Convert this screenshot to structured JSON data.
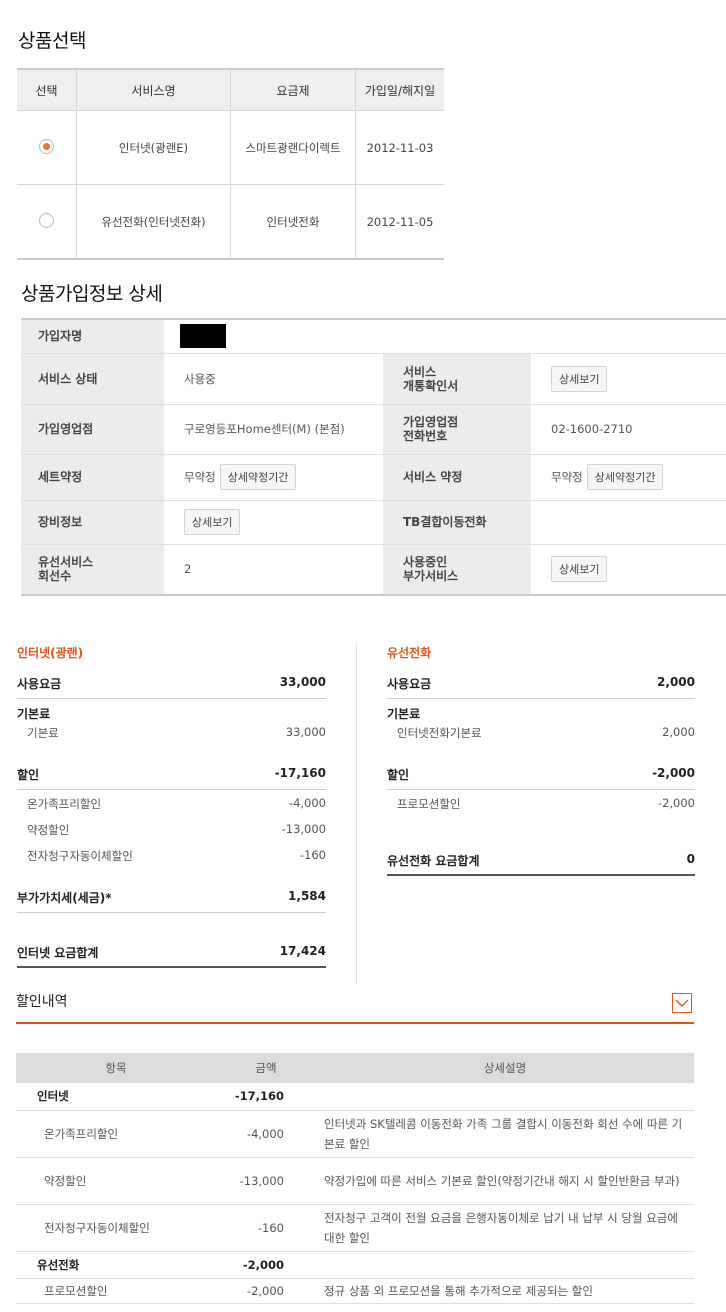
{
  "product_select": {
    "title": "상품선택",
    "headers": [
      "선택",
      "서비스명",
      "요금제",
      "가입일/해지일"
    ],
    "rows": [
      {
        "selected": true,
        "service": "인터넷(광랜E)",
        "plan": "스마트광랜다이렉트",
        "date": "2012-11-03"
      },
      {
        "selected": false,
        "service": "유선전화(인터넷전화)",
        "plan": "인터넷전화",
        "date": "2012-11-05"
      }
    ]
  },
  "detail": {
    "title": "상품가입정보 상세",
    "subscriber_label": "가입자명",
    "service_status_label": "서비스 상태",
    "service_status_value": "사용중",
    "service_cert_label1": "서비스",
    "service_cert_label2": "개통확인서",
    "view_button": "상세보기",
    "branch_label": "가입영업점",
    "branch_value": "구로영등포Home센터(M) (본점)",
    "branch_phone_label1": "가입영업점",
    "branch_phone_label2": "전화번호",
    "branch_phone_value": "02-1600-2710",
    "set_contract_label": "세트약정",
    "set_contract_value": "무약정",
    "contract_period_button": "상세약정기간",
    "service_contract_label": "서비스 약정",
    "service_contract_value": "무약정",
    "equipment_label": "장비정보",
    "tb_label": "TB결합이동전화",
    "wired_lines_label1": "유선서비스",
    "wired_lines_label2": "회선수",
    "wired_lines_value": "2",
    "addon_label1": "사용중인",
    "addon_label2": "부가서비스"
  },
  "internet_bill": {
    "title": "인터넷(광랜)",
    "usage_label": "사용요금",
    "usage_value": "33,000",
    "base_label": "기본료",
    "base_sub_label": "기본료",
    "base_sub_value": "33,000",
    "discount_label": "할인",
    "discount_value": "-17,160",
    "discount_items": [
      {
        "label": "온가족프리할인",
        "value": "-4,000"
      },
      {
        "label": "약정할인",
        "value": "-13,000"
      },
      {
        "label": "전자청구자동이체할인",
        "value": "-160"
      }
    ],
    "vat_label": "부가가치세(세금)*",
    "vat_value": "1,584",
    "total_label": "인터넷 요금합계",
    "total_value": "17,424"
  },
  "phone_bill": {
    "title": "유선전화",
    "usage_label": "사용요금",
    "usage_value": "2,000",
    "base_label": "기본료",
    "base_sub_label": "인터넷전화기본료",
    "base_sub_value": "2,000",
    "discount_label": "할인",
    "discount_value": "-2,000",
    "discount_items": [
      {
        "label": "프로모션할인",
        "value": "-2,000"
      }
    ],
    "total_label": "유선전화 요금합계",
    "total_value": "0"
  },
  "discount_history": {
    "title": "할인내역",
    "headers": [
      "항목",
      "금액",
      "상세설명"
    ],
    "groups": [
      {
        "name": "인터넷",
        "amount": "-17,160",
        "items": [
          {
            "name": "온가족프리할인",
            "amount": "-4,000",
            "desc": "인터넷과 SK텔레콤 이동전화 가족 그룹 결합시 이동전화 회선 수에 따른 기본료 할인"
          },
          {
            "name": "약정할인",
            "amount": "-13,000",
            "desc": "약정가입에 따른 서비스 기본료 할인(약정기간내 해지 시 할인반환금 부과)"
          },
          {
            "name": "전자청구자동이체할인",
            "amount": "-160",
            "desc": "전자청구 고객이 전월 요금을 은행자동이체로 납기 내 납부 시 당월 요금에 대한 할인"
          }
        ]
      },
      {
        "name": "유선전화",
        "amount": "-2,000",
        "items": [
          {
            "name": "프로모션할인",
            "amount": "-2,000",
            "desc": "정규 상품 외 프로모션을 통해 추가적으로 제공되는 할인"
          }
        ]
      }
    ]
  },
  "colors": {
    "accent": "#e0541e",
    "radio_selected": "#e8762d",
    "header_bg": "#f0efee"
  }
}
